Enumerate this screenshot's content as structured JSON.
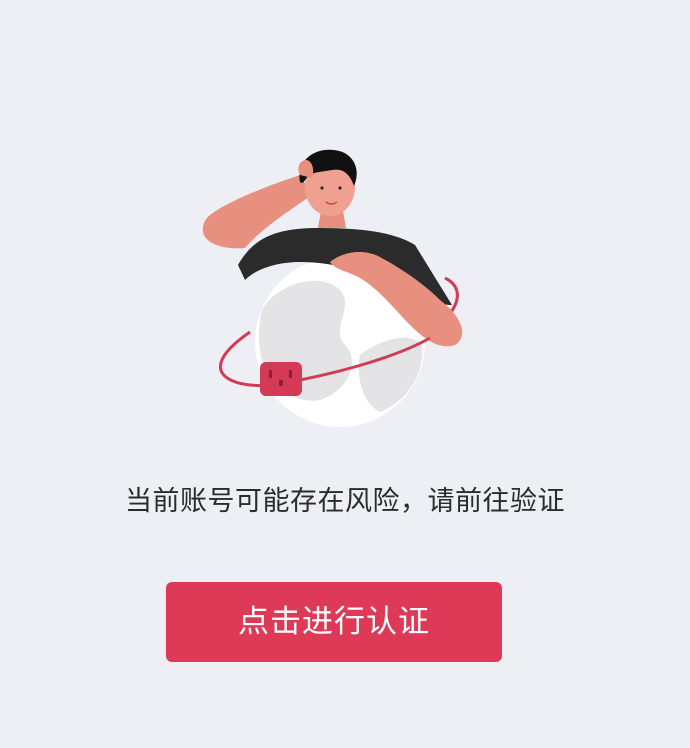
{
  "illustration": {
    "icon": "person-holding-globe-with-warning-socket-illustration",
    "accent_color": "#de3a58"
  },
  "message": {
    "text": "当前账号可能存在风险，请前往验证"
  },
  "verify_button": {
    "label": "点击进行认证",
    "background_color": "#de3a58",
    "text_color": "#ffffff"
  },
  "page": {
    "background_color": "#eeeff5"
  }
}
